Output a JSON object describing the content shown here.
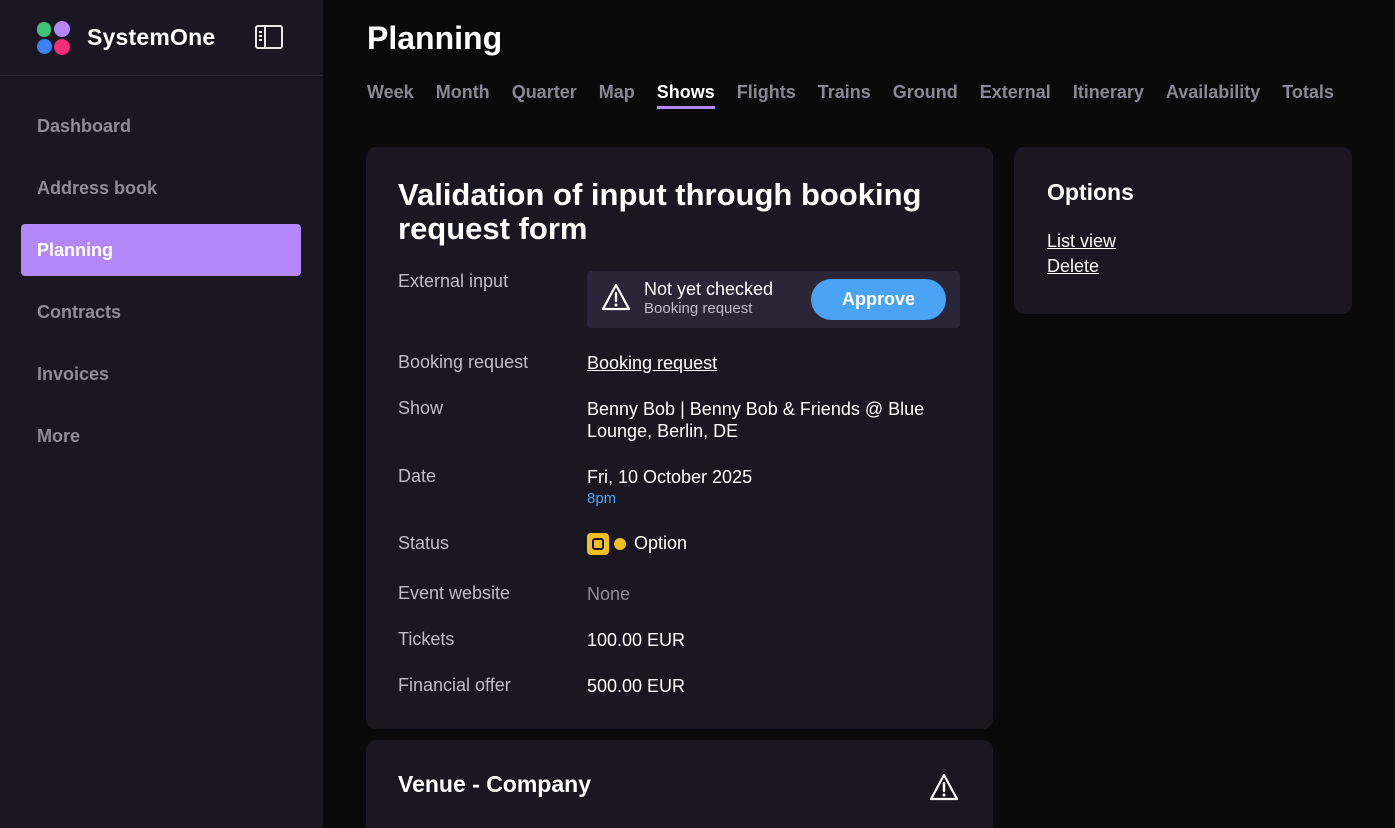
{
  "app": {
    "name": "SystemOne"
  },
  "sidebar": {
    "items": [
      {
        "label": "Dashboard",
        "active": false
      },
      {
        "label": "Address book",
        "active": false
      },
      {
        "label": "Planning",
        "active": true
      },
      {
        "label": "Contracts",
        "active": false
      },
      {
        "label": "Invoices",
        "active": false
      },
      {
        "label": "More",
        "active": false
      }
    ]
  },
  "header": {
    "title": "Planning"
  },
  "tabs": [
    {
      "label": "Week"
    },
    {
      "label": "Month"
    },
    {
      "label": "Quarter"
    },
    {
      "label": "Map"
    },
    {
      "label": "Shows",
      "active": true
    },
    {
      "label": "Flights"
    },
    {
      "label": "Trains"
    },
    {
      "label": "Ground"
    },
    {
      "label": "External"
    },
    {
      "label": "Itinerary"
    },
    {
      "label": "Availability"
    },
    {
      "label": "Totals"
    }
  ],
  "main": {
    "title": "Validation of input through booking request form",
    "external_input": {
      "label": "External input",
      "status": "Not yet checked",
      "source": "Booking request",
      "approve_label": "Approve"
    },
    "booking_request": {
      "label": "Booking request",
      "value": "Booking request"
    },
    "show": {
      "label": "Show",
      "value": "Benny Bob | Benny Bob & Friends @ Blue Lounge, Berlin, DE"
    },
    "date": {
      "label": "Date",
      "value": "Fri, 10 October 2025",
      "time": "8pm"
    },
    "status": {
      "label": "Status",
      "value": "Option",
      "color": "#f0c020"
    },
    "event_website": {
      "label": "Event website",
      "value": "None"
    },
    "tickets": {
      "label": "Tickets",
      "value": "100.00 EUR"
    },
    "financial_offer": {
      "label": "Financial offer",
      "value": "500.00 EUR"
    }
  },
  "options": {
    "title": "Options",
    "list_view": "List view",
    "delete": "Delete"
  },
  "venue": {
    "title": "Venue - Company"
  },
  "colors": {
    "accent": "#b388f6",
    "primary_button": "#4aa3f5",
    "sidebar_bg": "#1a1723"
  }
}
